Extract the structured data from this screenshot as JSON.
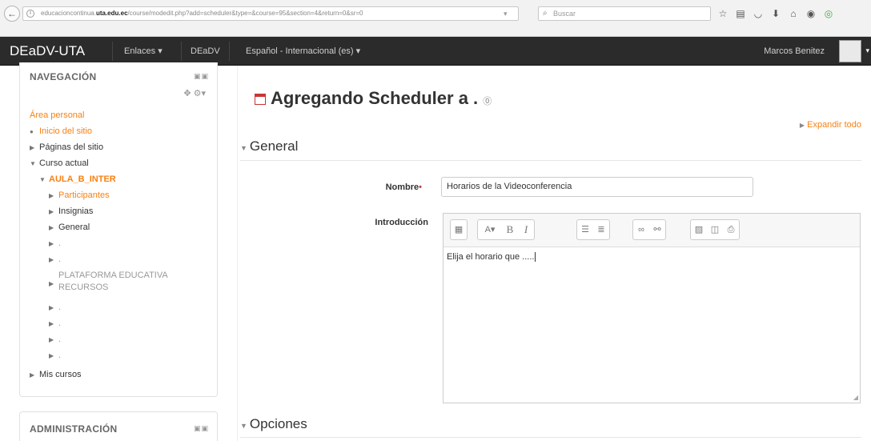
{
  "browser": {
    "url_prefix": "educacioncontinua.",
    "url_domain": "uta.edu.ec",
    "url_path": "/course/modedit.php?add=scheduler&type=&course=95&section=4&return=0&sr=0",
    "search_placeholder": "Buscar"
  },
  "navbar": {
    "brand": "DEaDV-UTA",
    "links": [
      "Enlaces ▾",
      "DEaDV",
      "Español - Internacional (es) ▾"
    ],
    "user_name": "Marcos Benitez"
  },
  "navigation_block": {
    "title": "NAVEGACIÓN",
    "items": [
      {
        "label": "Área personal"
      },
      {
        "label": "Inicio del sitio"
      },
      {
        "label": "Páginas del sitio"
      },
      {
        "label": "Curso actual"
      },
      {
        "label": "AULA_B_INTER"
      },
      {
        "label": "Participantes"
      },
      {
        "label": "Insignias"
      },
      {
        "label": "General"
      },
      {
        "label": "."
      },
      {
        "label": "."
      },
      {
        "label": "PLATAFORMA EDUCATIVA"
      },
      {
        "label": "RECURSOS"
      },
      {
        "label": "."
      },
      {
        "label": "."
      },
      {
        "label": "."
      },
      {
        "label": "."
      },
      {
        "label": "Mis cursos"
      }
    ]
  },
  "admin_block": {
    "title": "ADMINISTRACIÓN"
  },
  "main": {
    "heading": "Agregando Scheduler a .",
    "expand_all": "Expandir todo",
    "section_general": "General",
    "section_options": "Opciones",
    "name_label": "Nombre",
    "required_mark": "•",
    "name_value": "Horarios de la Videoconferencia",
    "intro_label": "Introducción",
    "intro_text": "Elija el horario que ....."
  },
  "colors": {
    "accent_orange": "#f98012",
    "navbar_bg": "#2b2b2b",
    "required_red": "#b94a48"
  },
  "icons": [
    "info-icon",
    "reload-icon",
    "search-icon",
    "star-icon",
    "reader-icon",
    "pocket-icon",
    "download-icon",
    "home-icon",
    "sync-icon",
    "extension-icon",
    "calendar-icon",
    "help-icon",
    "gear-icon",
    "move-icon"
  ]
}
